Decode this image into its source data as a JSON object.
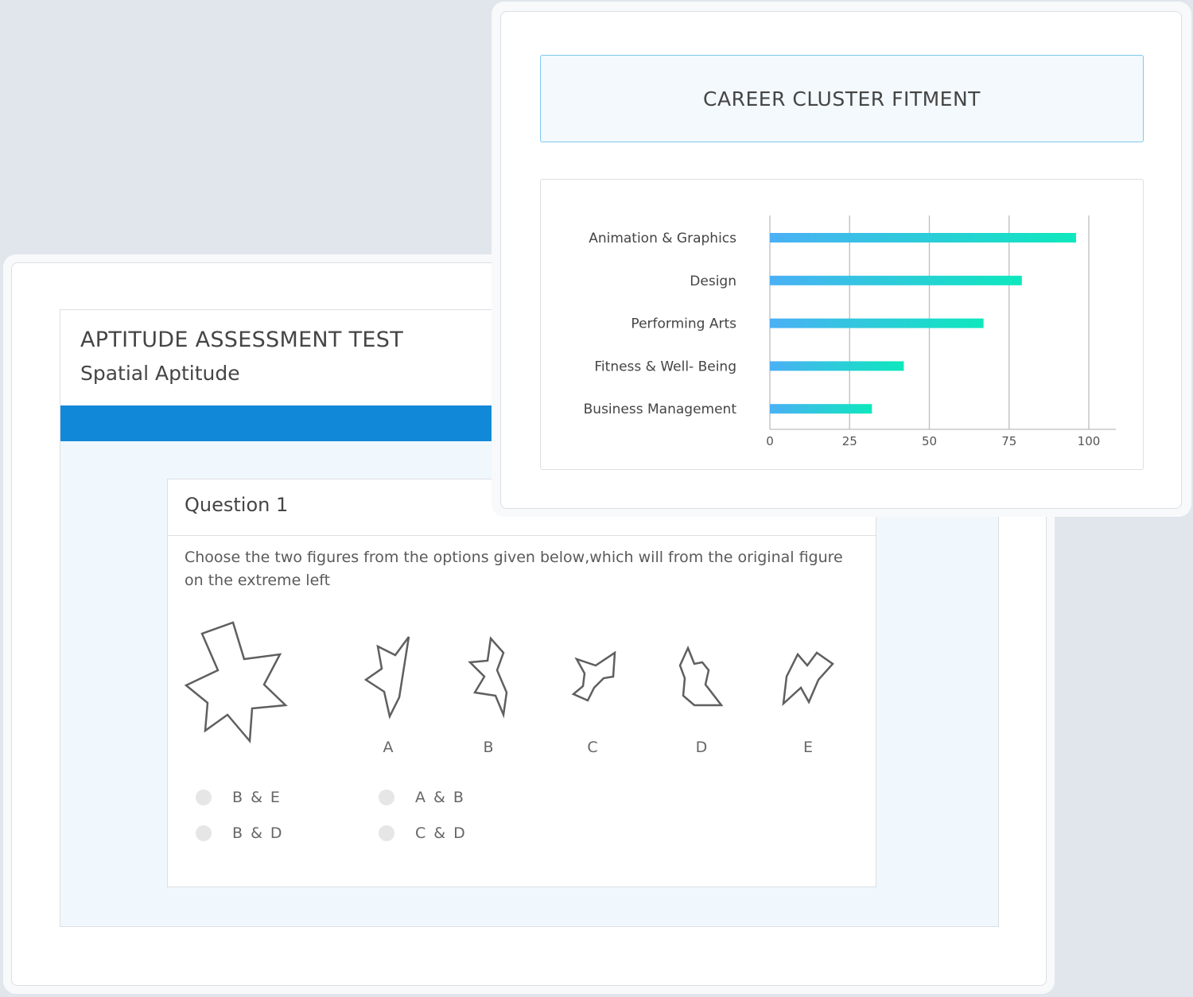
{
  "test": {
    "title": "APTITUDE ASSESSMENT TEST",
    "subtitle": "Spatial Aptitude"
  },
  "question": {
    "title": "Question 1",
    "text": "Choose the two figures from the options given below,which will from the original figure on the extreme left",
    "figure_labels": [
      "A",
      "B",
      "C",
      "D",
      "E"
    ],
    "options": [
      "B & E",
      "A & B",
      "B & D",
      "C & D"
    ]
  },
  "fitment": {
    "title": "CAREER CLUSTER FITMENT"
  },
  "chart_data": {
    "type": "bar",
    "orientation": "horizontal",
    "categories": [
      "Animation & Graphics",
      "Design",
      "Performing Arts",
      "Fitness & Well- Being",
      "Business Management"
    ],
    "values": [
      96,
      79,
      67,
      42,
      32
    ],
    "xticks": [
      0,
      25,
      50,
      75,
      100
    ],
    "xlim": [
      0,
      100
    ],
    "grid": true,
    "gradient": [
      "#4ab0f5",
      "#0de8bd"
    ]
  }
}
